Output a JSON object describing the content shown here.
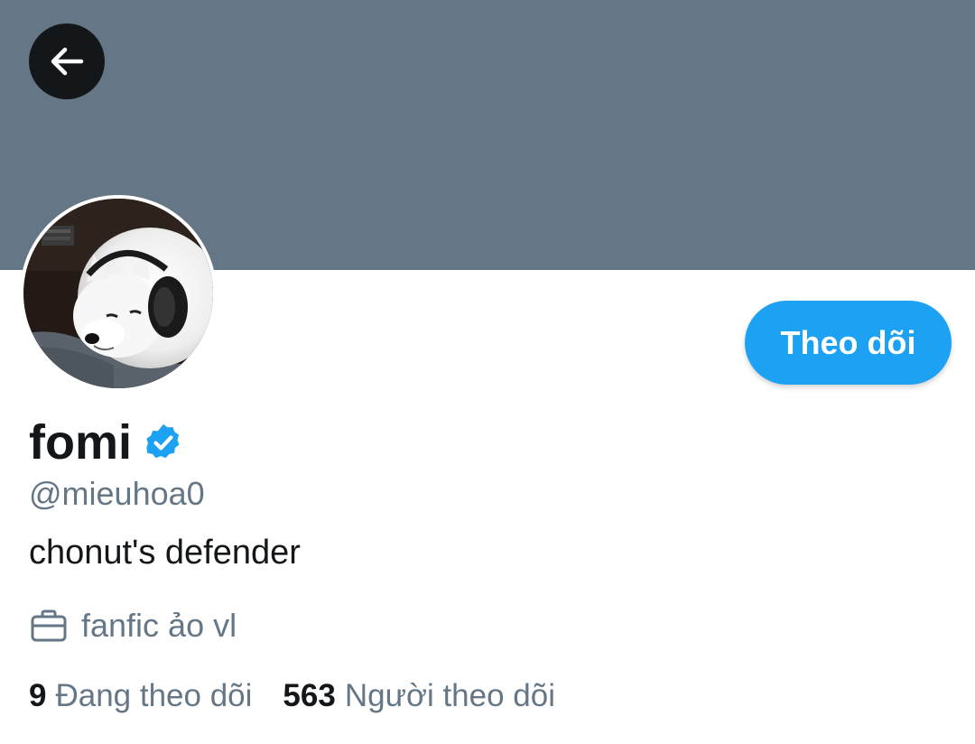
{
  "profile": {
    "banner_color": "#657786",
    "display_name": "fomi",
    "verified": true,
    "handle": "@mieuhoa0",
    "bio": "chonut's defender",
    "work_icon": "briefcase-icon",
    "work": "fanfic ảo vl",
    "avatar_description": "avatar-photo"
  },
  "actions": {
    "back_icon": "arrow-left-icon",
    "follow_label": "Theo dõi",
    "accent_color": "#1da1f2"
  },
  "stats": {
    "following_count": "9",
    "following_label": "Đang theo dõi",
    "followers_count": "563",
    "followers_label": "Người theo dõi"
  }
}
